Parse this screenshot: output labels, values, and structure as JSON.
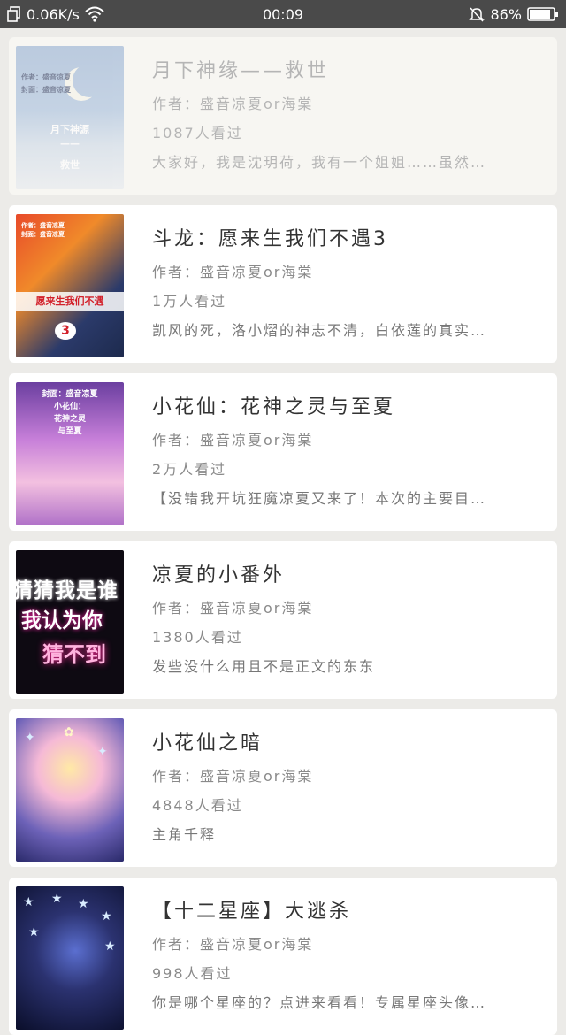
{
  "status_bar": {
    "speed": "0.06K/s",
    "time": "00:09",
    "battery": "86%"
  },
  "books": [
    {
      "title": "月下神缘——救世",
      "author": "作者：盛音凉夏or海棠",
      "views": "1087人看过",
      "desc": "大家好，我是沈玥荷，我有一个姐姐……虽然…",
      "cover_texts": [
        "作者：盛音凉夏",
        "封面：盛音凉夏",
        "月下神源",
        "——",
        "救世"
      ]
    },
    {
      "title": "斗龙：愿来生我们不遇3",
      "author": "作者：盛音凉夏or海棠",
      "views": "1万人看过",
      "desc": "凯风的死，洛小熠的神志不清，白依莲的真实…",
      "cover_texts": [
        "作者：盛音凉夏",
        "封面：盛音凉夏",
        "愿来生我们不遇",
        "3"
      ]
    },
    {
      "title": "小花仙：花神之灵与至夏",
      "author": "作者：盛音凉夏or海棠",
      "views": "2万人看过",
      "desc": "【没错我开坑狂魔凉夏又来了！本次的主要目…",
      "cover_texts": [
        "封面：盛音凉夏",
        "小花仙：",
        "花神之灵",
        "与至夏"
      ]
    },
    {
      "title": "凉夏的小番外",
      "author": "作者：盛音凉夏or海棠",
      "views": "1380人看过",
      "desc": "发些没什么用且不是正文的东东",
      "cover_texts": [
        "猜猜我是谁",
        "我认为你",
        "猜不到"
      ]
    },
    {
      "title": "小花仙之暗",
      "author": "作者：盛音凉夏or海棠",
      "views": "4848人看过",
      "desc": "主角千释",
      "cover_texts": []
    },
    {
      "title": "【十二星座】大逃杀",
      "author": "作者：盛音凉夏or海棠",
      "views": "998人看过",
      "desc": "你是哪个星座的？点进来看看！专属星座头像…",
      "cover_texts": []
    }
  ],
  "colors": {
    "statusbar_bg": "#4a4a4a",
    "page_bg": "#ecebe8",
    "card_bg": "#ffffff"
  }
}
